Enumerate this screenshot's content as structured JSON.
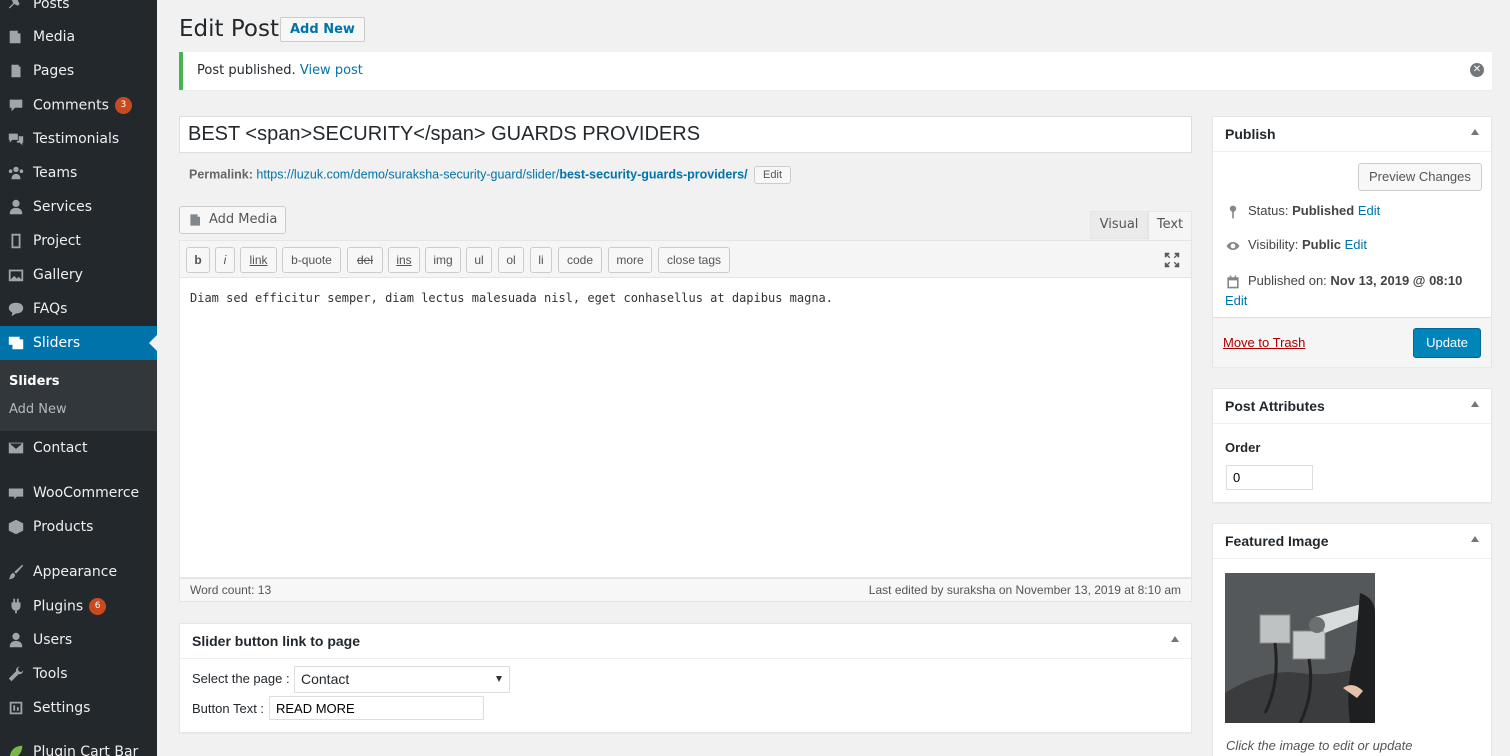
{
  "sidebar": {
    "items": [
      {
        "label": "Posts",
        "icon": "pin-icon"
      },
      {
        "label": "Media",
        "icon": "media-icon"
      },
      {
        "label": "Pages",
        "icon": "pages-icon"
      },
      {
        "label": "Comments",
        "icon": "comment-icon",
        "badge": "3"
      },
      {
        "label": "Testimonials",
        "icon": "testimonial-icon"
      },
      {
        "label": "Teams",
        "icon": "groups-icon"
      },
      {
        "label": "Services",
        "icon": "services-icon"
      },
      {
        "label": "Project",
        "icon": "project-icon"
      },
      {
        "label": "Gallery",
        "icon": "gallery-icon"
      },
      {
        "label": "FAQs",
        "icon": "faq-icon"
      },
      {
        "label": "Sliders",
        "icon": "slides-icon",
        "active": true
      },
      {
        "label": "Contact",
        "icon": "mail-icon"
      },
      {
        "label": "WooCommerce",
        "icon": "woocommerce-icon"
      },
      {
        "label": "Products",
        "icon": "archive-icon"
      },
      {
        "label": "Appearance",
        "icon": "brush-icon"
      },
      {
        "label": "Plugins",
        "icon": "plugin-icon",
        "badge": "6"
      },
      {
        "label": "Users",
        "icon": "user-icon"
      },
      {
        "label": "Tools",
        "icon": "wrench-icon"
      },
      {
        "label": "Settings",
        "icon": "settings-icon"
      },
      {
        "label": "Plugin Cart Bar",
        "icon": "leaf-icon"
      }
    ],
    "submenu": {
      "current": "Sliders",
      "add_new": "Add New"
    },
    "accent_color": "#0073aa"
  },
  "header": {
    "title": "Edit Post",
    "add_new": "Add New"
  },
  "notice": {
    "text": "Post published.",
    "link": "View post",
    "color": "#46b450"
  },
  "post": {
    "title": "BEST <span>SECURITY</span> GUARDS PROVIDERS",
    "permalink_label": "Permalink:",
    "permalink_base": "https://luzuk.com/demo/suraksha-security-guard/slider/",
    "permalink_slug": "best-security-guards-providers/",
    "permalink_edit": "Edit"
  },
  "editor": {
    "add_media": "Add Media",
    "tab_visual": "Visual",
    "tab_text": "Text",
    "quicktags": [
      "b",
      "i",
      "link",
      "b-quote",
      "del",
      "ins",
      "img",
      "ul",
      "ol",
      "li",
      "code",
      "more",
      "close tags"
    ],
    "content": "Diam sed efficitur semper, diam lectus malesuada nisl, eget conhasellus at dapibus magna.",
    "word_count": "Word count: 13",
    "last_edited": "Last edited by suraksha on November 13, 2019 at 8:10 am"
  },
  "slider_box": {
    "title": "Slider button link to page",
    "select_label": "Select the page :",
    "select_value": "Contact",
    "button_text_label": "Button Text :",
    "button_text_value": "READ MORE"
  },
  "publish": {
    "title": "Publish",
    "preview": "Preview Changes",
    "status_label": "Status:",
    "status_value": "Published",
    "visibility_label": "Visibility:",
    "visibility_value": "Public",
    "published_label": "Published on:",
    "published_value": "Nov 13, 2019 @ 08:10",
    "edit": "Edit",
    "trash": "Move to Trash",
    "update": "Update"
  },
  "attributes": {
    "title": "Post Attributes",
    "order_label": "Order",
    "order_value": "0"
  },
  "featured": {
    "title": "Featured Image",
    "caption": "Click the image to edit or update"
  }
}
